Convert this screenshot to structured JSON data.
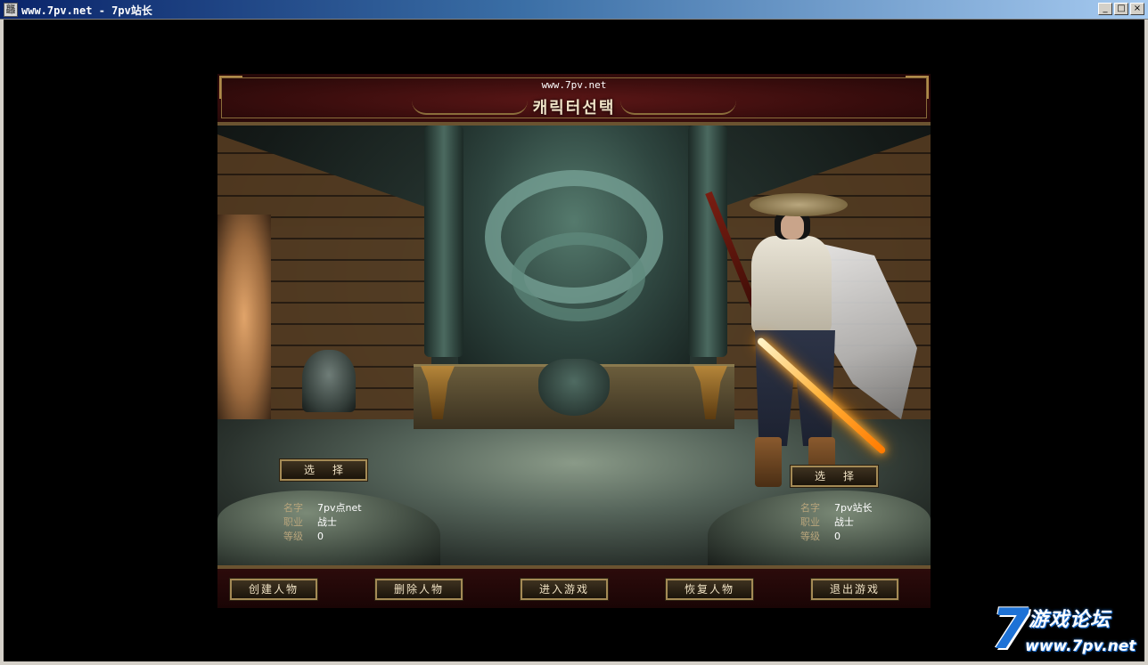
{
  "window": {
    "icon_glyph": "龘",
    "title": "www.7pv.net - 7pv站长",
    "buttons": {
      "minimize": "_",
      "maximize": "□",
      "close": "×"
    }
  },
  "game": {
    "site_url": "www.7pv.net",
    "screen_title": "캐릭터선택",
    "left_slot": {
      "select_label": "选择",
      "info": [
        {
          "label": "名字",
          "value": "7pv点net"
        },
        {
          "label": "职业",
          "value": "战士"
        },
        {
          "label": "等级",
          "value": "0"
        }
      ]
    },
    "right_slot": {
      "select_label": "选择",
      "info": [
        {
          "label": "名字",
          "value": "7pv站长"
        },
        {
          "label": "职业",
          "value": "战士"
        },
        {
          "label": "等级",
          "value": "0"
        }
      ]
    },
    "footer_buttons": [
      "创建人物",
      "删除人物",
      "进入游戏",
      "恢复人物",
      "退出游戏"
    ]
  },
  "watermark": {
    "logo_number": "7",
    "text": "游戏论坛",
    "url": "www.7pv.net"
  },
  "colors": {
    "titlebar_start": "#0a246a",
    "button_border": "#a48a55",
    "label_gold": "#b8a57c",
    "watermark_blue": "#1e72d6"
  }
}
